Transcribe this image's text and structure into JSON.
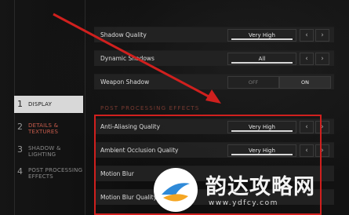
{
  "sidebar": {
    "items": [
      {
        "num": "1",
        "label": "DISPLAY",
        "active": true
      },
      {
        "num": "2",
        "label": "DETAILS & TEXTURES",
        "active": false
      },
      {
        "num": "3",
        "label": "SHADOW & LIGHTING",
        "active": false
      },
      {
        "num": "4",
        "label": "POST PROCESSING EFFECTS",
        "active": false
      }
    ]
  },
  "settings_top": {
    "shadow_quality": {
      "label": "Shadow Quality",
      "value": "Very High",
      "level": 1.0
    },
    "dynamic_shadows": {
      "label": "Dynamic Shadows",
      "value": "All",
      "level": 1.0
    },
    "weapon_shadow": {
      "label": "Weapon Shadow",
      "off": "OFF",
      "on": "ON",
      "state": "on"
    }
  },
  "post_processing": {
    "title": "POST PROCESSING EFFECTS",
    "anti_aliasing": {
      "label": "Anti-Aliasing Quality",
      "value": "Very High",
      "level": 1.0
    },
    "ambient_occlusion": {
      "label": "Ambient Occlusion Quality",
      "value": "Very High",
      "level": 1.0
    },
    "motion_blur": {
      "label": "Motion Blur"
    },
    "motion_blur_quality": {
      "label": "Motion Blur Quality"
    }
  },
  "arrows": {
    "left": "‹",
    "right": "›"
  },
  "watermark": {
    "text": "韵达攻略网",
    "url": "www.ydfcy.com"
  },
  "colors": {
    "accent_red": "#d0201e",
    "watermark_blue": "#2f8ad8",
    "watermark_orange": "#f5a623"
  }
}
